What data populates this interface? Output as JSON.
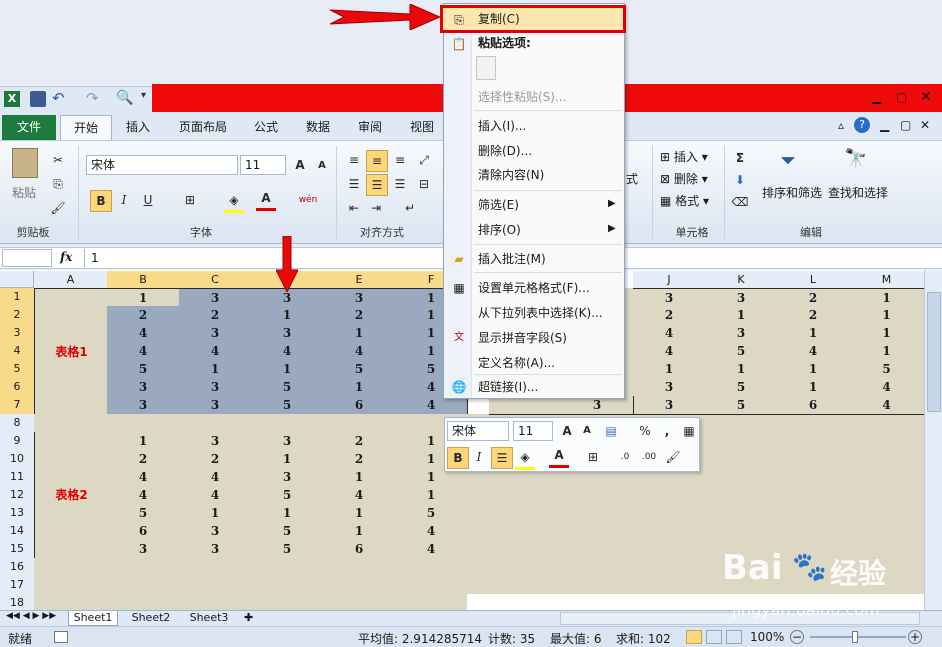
{
  "app": {
    "file_tab": "文件"
  },
  "tabs": [
    "开始",
    "插入",
    "页面布局",
    "公式",
    "数据",
    "审阅",
    "视图"
  ],
  "ribbon": {
    "clipboard": {
      "paste_label": "粘贴",
      "group_label": "剪贴板"
    },
    "font": {
      "name": "宋体",
      "size": "11",
      "group_label": "字体",
      "bold": "B",
      "italic": "I",
      "underline": "U",
      "grow": "A",
      "shrink": "A",
      "color_a": "A",
      "wen": "wén"
    },
    "align": {
      "group_label": "对齐方式"
    },
    "number": {
      "peek": "式"
    },
    "cells": {
      "insert": "插入",
      "delete": "删除",
      "format": "格式",
      "group_label": "单元格"
    },
    "editing": {
      "sort_filter": "排序和筛选",
      "find_select": "查找和选择",
      "group_label": "编辑",
      "sigma": "Σ"
    }
  },
  "formula_bar": {
    "name_box": "",
    "fx": "fx",
    "value": "1"
  },
  "columns": [
    "A",
    "B",
    "C",
    "D",
    "E",
    "F",
    "J",
    "K",
    "L",
    "M"
  ],
  "rows": [
    "1",
    "2",
    "3",
    "4",
    "5",
    "6",
    "7",
    "8",
    "9",
    "10",
    "11",
    "12",
    "13",
    "14",
    "15",
    "16",
    "17",
    "18"
  ],
  "table1": {
    "label": "表格1",
    "data": [
      [
        "1",
        "3",
        "3",
        "3",
        "1"
      ],
      [
        "2",
        "2",
        "1",
        "2",
        "1"
      ],
      [
        "4",
        "3",
        "3",
        "1",
        "1"
      ],
      [
        "4",
        "4",
        "4",
        "4",
        "1"
      ],
      [
        "5",
        "1",
        "1",
        "5",
        "5"
      ],
      [
        "3",
        "3",
        "5",
        "1",
        "4"
      ],
      [
        "3",
        "3",
        "5",
        "6",
        "4"
      ]
    ]
  },
  "table2": {
    "label": "表格2",
    "data": [
      [
        "1",
        "3",
        "3",
        "2",
        "1"
      ],
      [
        "2",
        "2",
        "1",
        "2",
        "1"
      ],
      [
        "4",
        "4",
        "3",
        "1",
        "1"
      ],
      [
        "4",
        "4",
        "5",
        "4",
        "1"
      ],
      [
        "5",
        "1",
        "1",
        "1",
        "5"
      ],
      [
        "6",
        "3",
        "5",
        "1",
        "4"
      ],
      [
        "3",
        "3",
        "5",
        "6",
        "4"
      ]
    ]
  },
  "right_table": {
    "data": [
      [
        "3",
        "3",
        "2",
        "1"
      ],
      [
        "2",
        "1",
        "2",
        "1"
      ],
      [
        "4",
        "3",
        "1",
        "1"
      ],
      [
        "4",
        "5",
        "4",
        "1"
      ],
      [
        "1",
        "1",
        "1",
        "5"
      ],
      [
        "3",
        "5",
        "1",
        "4"
      ],
      [
        "3",
        "5",
        "6",
        "4"
      ]
    ],
    "row7_extra": "3"
  },
  "context_menu": {
    "items": [
      {
        "label": "复制(C)",
        "icon": "copy-icon",
        "disabled": false
      },
      {
        "label": "粘贴选项:",
        "icon": "paste-icon",
        "disabled": false,
        "bold": true
      },
      {
        "label": "选择性粘贴(S)...",
        "icon": "",
        "disabled": true
      },
      {
        "label": "插入(I)...",
        "icon": "",
        "disabled": false
      },
      {
        "label": "删除(D)...",
        "icon": "",
        "disabled": false
      },
      {
        "label": "清除内容(N)",
        "icon": "",
        "disabled": false
      },
      {
        "label": "筛选(E)",
        "icon": "",
        "disabled": false,
        "submenu": true
      },
      {
        "label": "排序(O)",
        "icon": "",
        "disabled": false,
        "submenu": true
      },
      {
        "label": "插入批注(M)",
        "icon": "comment-icon",
        "disabled": false
      },
      {
        "label": "设置单元格格式(F)...",
        "icon": "format-cells-icon",
        "disabled": false
      },
      {
        "label": "从下拉列表中选择(K)...",
        "icon": "",
        "disabled": false
      },
      {
        "label": "显示拼音字段(S)",
        "icon": "phonetic-icon",
        "disabled": false
      },
      {
        "label": "定义名称(A)...",
        "icon": "",
        "disabled": false
      },
      {
        "label": "超链接(I)...",
        "icon": "hyperlink-icon",
        "disabled": false
      }
    ]
  },
  "mini_toolbar": {
    "font": "宋体",
    "size": "11",
    "percent": "%",
    "comma": ","
  },
  "sheets": [
    "Sheet1",
    "Sheet2",
    "Sheet3"
  ],
  "status": {
    "mode": "就绪",
    "average": "平均值: 2.914285714",
    "count": "计数: 35",
    "max": "最大值: 6",
    "sum": "求和: 102",
    "zoom": "100%"
  },
  "watermark": {
    "brand": "Bai",
    "brand2": "经验",
    "url": "jingyan.baidu.com"
  },
  "colors": {
    "highlight_red": "#f00a0a",
    "selection": "#9aa9c0",
    "table_bg": "#ddd8c4",
    "label_red": "#e00000"
  }
}
